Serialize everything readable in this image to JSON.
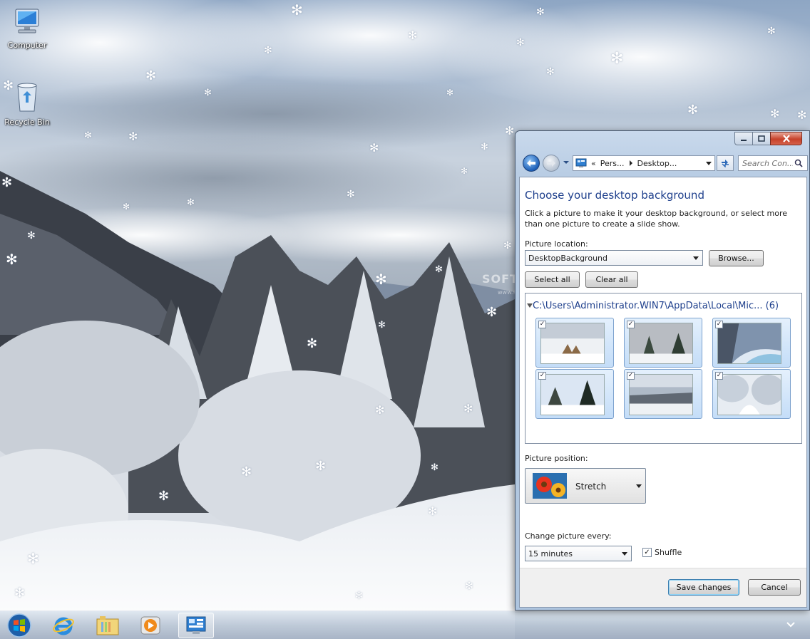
{
  "desktop": {
    "icons": [
      {
        "label": "Computer"
      },
      {
        "label": "Recycle Bin"
      }
    ],
    "watermark": "SOFT",
    "watermark_sub": "www.softpedia.com"
  },
  "window": {
    "address": {
      "overflow": "«",
      "segments": [
        "Pers...",
        "Desktop..."
      ]
    },
    "search_placeholder": "Search Con...",
    "heading": "Choose your desktop background",
    "description": "Click a picture to make it your desktop background, or select more than one picture to create a slide show.",
    "picture_location_label": "Picture location:",
    "picture_location_value": "DesktopBackground",
    "browse_label": "Browse...",
    "select_all_label": "Select all",
    "clear_all_label": "Clear all",
    "gallery": {
      "path": "C:\\Users\\Administrator.WIN7\\AppData\\Local\\Mic... (6)",
      "thumbnails": [
        {
          "checked": true
        },
        {
          "checked": true
        },
        {
          "checked": true
        },
        {
          "checked": true
        },
        {
          "checked": true
        },
        {
          "checked": true
        }
      ],
      "check_glyph": "✓"
    },
    "picture_position_label": "Picture position:",
    "picture_position_value": "Stretch",
    "change_every_label": "Change picture every:",
    "change_every_value": "15 minutes",
    "shuffle_label": "Shuffle",
    "shuffle_checked": true,
    "save_label": "Save changes",
    "cancel_label": "Cancel"
  },
  "colors": {
    "heading_blue": "#1e3f8c",
    "taskbar_tint": "#8ca0b9"
  }
}
